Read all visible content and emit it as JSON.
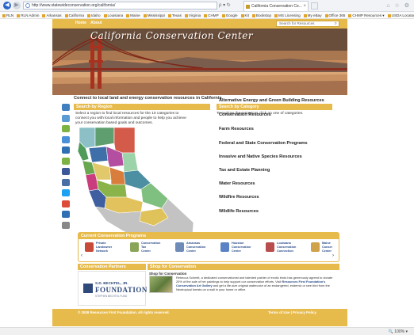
{
  "browser": {
    "url": "http://www.statewideconservation.org/california/",
    "url_tools": "ρ ▾ ↻",
    "tab_title": "California Conservation Ce...",
    "tab_close": "×",
    "window_icons": "⌂ ☆ ⚙",
    "favorites": [
      "RLN",
      "RLN Admin",
      "Arkansas",
      "California",
      "Idaho",
      "Louisiana",
      "Maine",
      "Mississippi",
      "Texas",
      "Virginia",
      "CHMP",
      "Google",
      "Kit",
      "Bookstop",
      "MS Licensing",
      "My eBay",
      "Office 365",
      "CHMP Resources ▾",
      "USDA Locator"
    ],
    "zoom": "🔍 100% ▾"
  },
  "site": {
    "nav": [
      "Home",
      "About"
    ],
    "search_placeholder": "Search for Resources",
    "banner_title": "California Conservation Center",
    "tagline": "Connect to local land and energy conservation resources in California",
    "region": {
      "heading": "Search by Region",
      "description": "Select a region to find local resources for the 10 categories to connect you with local information and people to help you achieve your conservation based goals and outcomes."
    },
    "category": {
      "heading": "Search by Category",
      "description": "To explore the resources click on one of categories.",
      "items": [
        "Alternative Energy and Green Building Resources",
        "Conservation Resources",
        "Farm Resources",
        "Federal and State Conservation Programs",
        "Invasive and Native Species Resources",
        "Tax and Estate Planning",
        "Water Resources",
        "Wildfire Resources",
        "Wildlife Resources"
      ]
    },
    "programs": {
      "heading": "Current Conservation Programs",
      "items": [
        "Private\nLandowner\nNetwork",
        "Conservation\nTax\nCenter",
        "Arkansas\nConservation\nCenter",
        "Houston\nConservation\nCenter",
        "Louisiana\nConservation\nConnection",
        "Maine\nConser\nCenter"
      ],
      "thumb_colors": [
        "#c84b3a",
        "#8aa45a",
        "#6f8bb8",
        "#5b82c4",
        "#b94c4c",
        "#d0a24a"
      ]
    },
    "partners": {
      "heading": "Conservation Partners",
      "logo_line1": "S.D. BECHTEL, JR.",
      "logo_line2": "FOUNDATION",
      "logo_line3": "STEPHEN BECHTEL FUND"
    },
    "shop": {
      "heading": "Shop for Conservation",
      "title": "Shop for Conservation",
      "text_part1": "Rebecca Schmitt, a dedicated conservationist and talented painter of exotic birds has generously agreed to donate 20% of the sale of her paintings to help support our conservation efforts.  Visit",
      "link": "Resources First Foundation's Conservation Art Gallery",
      "text_part2": "and get a life-size original watercolor of an endangered, endemic or rare bird from the Neotropical forests on a wall in your home or office."
    },
    "footer": {
      "copyright": "© 2008 Resources First Foundation. All rights reserved.",
      "links": "Terms of Use | Privacy Policy"
    }
  },
  "colors": {
    "accent_gold": "#e7ba4c",
    "link_blue": "#2d4f8b"
  },
  "share_icons": [
    "bookmark-icon",
    "print-icon",
    "email-icon",
    "chat-icon",
    "calendar-icon",
    "share-icon",
    "facebook-icon",
    "like-icon",
    "twitter-icon",
    "google-icon",
    "digg-icon",
    "more-icon"
  ]
}
